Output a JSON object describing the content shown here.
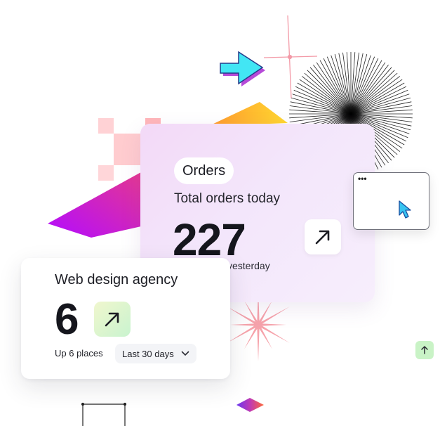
{
  "orders_card": {
    "pill": "Orders",
    "subtitle": "Total orders today",
    "value": "227",
    "comparison": "yesterday",
    "arrow_icon": "arrow-up-right-icon"
  },
  "agency_card": {
    "title": "Web design agency",
    "value": "6",
    "arrow_icon": "arrow-up-right-icon",
    "note": "Up 6 places",
    "period_select": {
      "selected": "Last 30 days",
      "icon": "chevron-down-icon"
    }
  },
  "mini_window": {
    "dots": "•••",
    "icon": "cursor-arrow-icon"
  },
  "up_button": {
    "icon": "arrow-up-icon"
  },
  "colors": {
    "accent_purple": "#b62ee8",
    "accent_cyan": "#4fe0ef",
    "accent_pink": "#f39aa7",
    "accent_yellow": "#ffcf2e",
    "accent_green": "#c9f3c6"
  }
}
